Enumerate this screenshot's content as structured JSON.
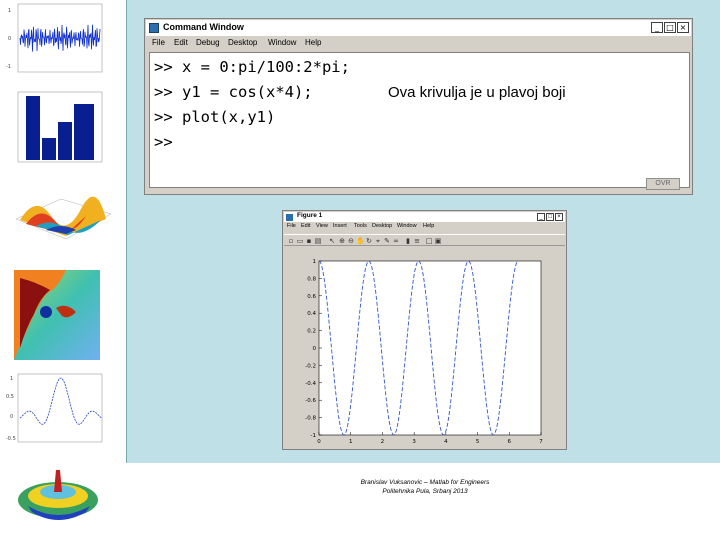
{
  "command_window": {
    "title": "Command Window",
    "dock_icon": "dock-arrow-icon",
    "menu": [
      "File",
      "Edit",
      "Debug",
      "Desktop",
      "Window",
      "Help"
    ],
    "lines": [
      ">> x = 0:pi/100:2*pi;",
      ">> y1 = cos(x*4);",
      ">> plot(x,y1)",
      ">>"
    ],
    "annotation": "Ova krivulja je u plavoj boji",
    "status_indicator": "OVR"
  },
  "figure_window": {
    "title": "Figure 1",
    "menu": [
      "File",
      "Edit",
      "View",
      "Insert",
      "Tools",
      "Desktop",
      "Window",
      "Help"
    ],
    "toolbar_icons": [
      "new-icon",
      "open-icon",
      "save-icon",
      "print-icon",
      "arrow-icon",
      "zoom-in-icon",
      "zoom-out-icon",
      "pan-icon",
      "rotate-icon",
      "datacursor-icon",
      "brush-icon",
      "link-icon",
      "colorbar-icon",
      "legend-icon",
      "hide-icon",
      "show-icon"
    ]
  },
  "chart_data": {
    "type": "line",
    "function": "y = cos(4x)",
    "x_range": [
      0,
      6.2832
    ],
    "xlim": [
      0,
      7
    ],
    "ylim": [
      -1,
      1
    ],
    "x_ticks": [
      "0",
      "1",
      "2",
      "3",
      "4",
      "5",
      "6",
      "7"
    ],
    "y_ticks": [
      "-1",
      "-0.8",
      "-0.6",
      "-0.4",
      "-0.2",
      "0",
      "0.2",
      "0.4",
      "0.6",
      "0.8",
      "1"
    ],
    "series": [
      {
        "color": "#3355cc",
        "style": "dashed"
      }
    ]
  },
  "footer": {
    "line1": "Branislav Vuksanovic – Matlab for Engineers",
    "line2": "Politehnika Pula, Srbanj 2013"
  },
  "colors": {
    "slide_background": "#bfe0e6",
    "curve": "#3355cc"
  }
}
